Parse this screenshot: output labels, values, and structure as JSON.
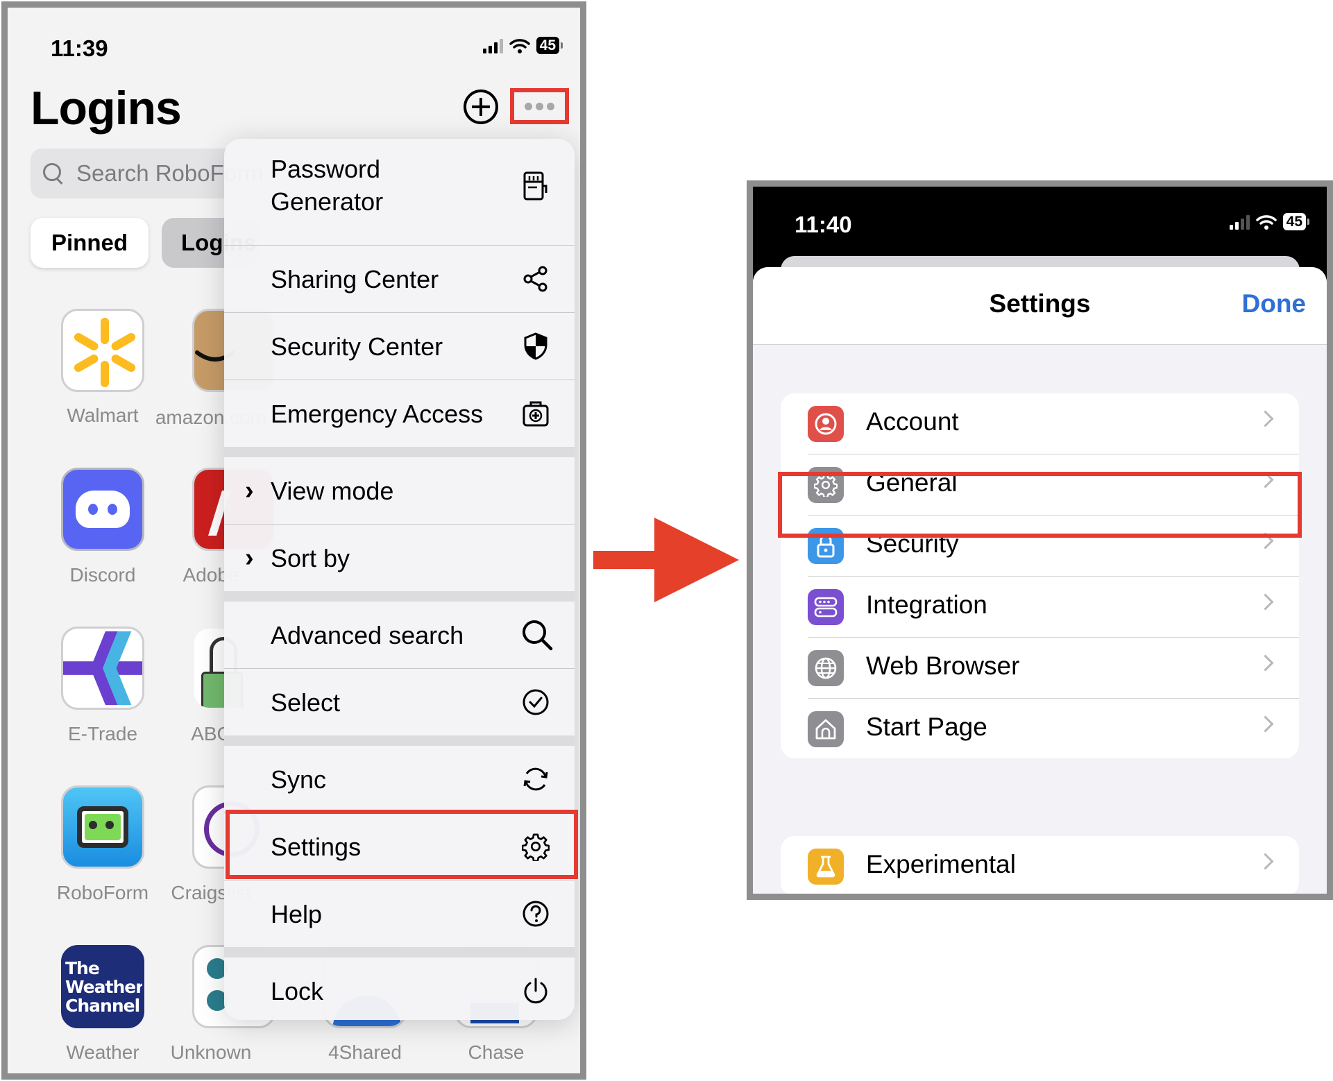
{
  "left_screen": {
    "status": {
      "time": "11:39",
      "battery": "45"
    },
    "title": "Logins",
    "search": {
      "placeholder": "Search RoboForm"
    },
    "tabs": [
      {
        "label": "Pinned"
      },
      {
        "label": "Logins"
      }
    ],
    "apps": [
      {
        "label": "Walmart"
      },
      {
        "label": "amazon.com"
      },
      {
        "label": "Discord"
      },
      {
        "label": "Adobe"
      },
      {
        "label": "E-Trade"
      },
      {
        "label": "ABC"
      },
      {
        "label": "RoboForm"
      },
      {
        "label": "Craigslist"
      },
      {
        "label": "Weather"
      },
      {
        "label": "Unknown"
      },
      {
        "label": "4Shared"
      },
      {
        "label": "Chase"
      }
    ],
    "weather_logo_text": [
      "The",
      "Weather",
      "Channel"
    ],
    "menu": {
      "items": [
        {
          "label_line1": "Password",
          "label_line2": "Generator",
          "icon": "password-generator-icon"
        },
        {
          "label": "Sharing Center",
          "icon": "share-icon"
        },
        {
          "label": "Security Center",
          "icon": "shield-icon"
        },
        {
          "label": "Emergency Access",
          "icon": "emergency-kit-icon"
        },
        {
          "label": "View mode",
          "icon": "chevron-right-icon"
        },
        {
          "label": "Sort by",
          "icon": "chevron-right-icon"
        },
        {
          "label": "Advanced search",
          "icon": "search-icon"
        },
        {
          "label": "Select",
          "icon": "checkmark-circle-icon"
        },
        {
          "label": "Sync",
          "icon": "sync-icon"
        },
        {
          "label": "Settings",
          "icon": "gear-icon"
        },
        {
          "label": "Help",
          "icon": "question-circle-icon"
        },
        {
          "label": "Lock",
          "icon": "power-icon"
        }
      ]
    },
    "highlight_color": "#e53a31"
  },
  "right_screen": {
    "status": {
      "time": "11:40",
      "battery": "45"
    },
    "header": {
      "title": "Settings",
      "done_label": "Done"
    },
    "rows": [
      {
        "label": "Account",
        "icon": "account-icon",
        "color": "#e0504a"
      },
      {
        "label": "General",
        "icon": "gear-icon",
        "color": "#8e8e93"
      },
      {
        "label": "Security",
        "icon": "lock-icon",
        "color": "#3d97e8"
      },
      {
        "label": "Integration",
        "icon": "integration-icon",
        "color": "#7a4fd0"
      },
      {
        "label": "Web Browser",
        "icon": "globe-icon",
        "color": "#8e8e93"
      },
      {
        "label": "Start Page",
        "icon": "home-icon",
        "color": "#8e8e93"
      }
    ],
    "experimental": {
      "label": "Experimental",
      "icon": "flask-icon",
      "color": "#f0b028"
    },
    "accent_color": "#2f6fd6"
  }
}
